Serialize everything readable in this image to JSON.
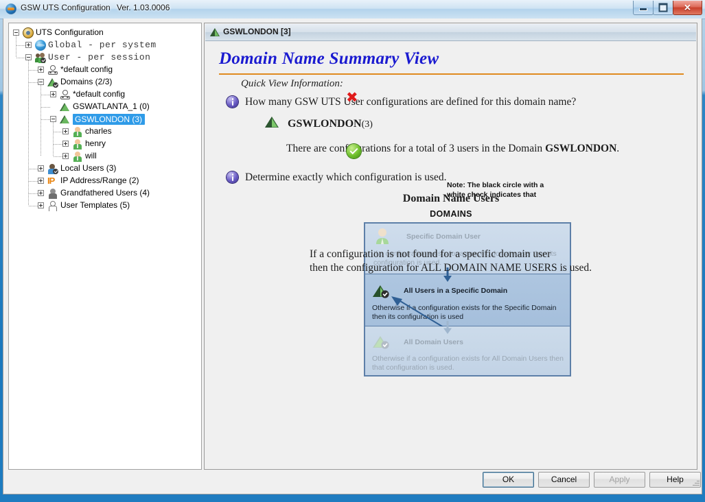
{
  "window": {
    "title": "GSW UTS Configuration",
    "version": "Ver. 1.03.0006",
    "icon": "app-globe-icon",
    "minimize_label": "–",
    "maximize_label": "",
    "close_label": "✕"
  },
  "tree": {
    "items": [
      {
        "label": "UTS Configuration",
        "icon": "gear-icon",
        "depth": 0,
        "expander": "minus",
        "selected": false,
        "mono": false
      },
      {
        "label": "Global  -  per system",
        "icon": "globe-icon",
        "depth": 1,
        "expander": "plus",
        "selected": false,
        "mono": true
      },
      {
        "label": "User  -  per session",
        "icon": "users-icon",
        "depth": 1,
        "expander": "minus",
        "selected": false,
        "mono": true
      },
      {
        "label": "*default config",
        "icon": "config-icon",
        "depth": 2,
        "expander": "plus",
        "selected": false,
        "mono": false
      },
      {
        "label": "Domains (2/3)",
        "icon": "domain-check-icon",
        "depth": 2,
        "expander": "minus",
        "selected": false,
        "mono": false
      },
      {
        "label": "*default config",
        "icon": "config-icon",
        "depth": 3,
        "expander": "plus",
        "selected": false,
        "mono": false
      },
      {
        "label": "GSWATLANTA_1 (0)",
        "icon": "domain-icon",
        "depth": 3,
        "expander": "none",
        "selected": false,
        "mono": false
      },
      {
        "label": "GSWLONDON (3)",
        "icon": "domain-icon",
        "depth": 3,
        "expander": "minus",
        "selected": true,
        "mono": false
      },
      {
        "label": "charles",
        "icon": "user-icon",
        "depth": 4,
        "expander": "plus",
        "selected": false,
        "mono": false
      },
      {
        "label": "henry",
        "icon": "user-icon",
        "depth": 4,
        "expander": "plus",
        "selected": false,
        "mono": false
      },
      {
        "label": "will",
        "icon": "user-icon",
        "depth": 4,
        "expander": "plus",
        "selected": false,
        "mono": false
      },
      {
        "label": "Local Users (3)",
        "icon": "local-user-icon",
        "depth": 2,
        "expander": "plus",
        "selected": false,
        "mono": false
      },
      {
        "label": "IP Address/Range (2)",
        "icon": "ip-icon",
        "depth": 2,
        "expander": "plus",
        "selected": false,
        "mono": false
      },
      {
        "label": "Grandfathered Users (4)",
        "icon": "gray-user-icon",
        "depth": 2,
        "expander": "plus",
        "selected": false,
        "mono": false
      },
      {
        "label": "User Templates (5)",
        "icon": "outline-user-icon",
        "depth": 2,
        "expander": "plus",
        "selected": false,
        "mono": false
      }
    ]
  },
  "panel": {
    "header": "GSWLONDON [3]",
    "header_icon": "domain-icon",
    "title": "Domain Name Summary View",
    "quick_view_label": "Quick View Information:",
    "question_1": "How many GSW UTS User configurations are defined for this domain name?",
    "domain_name": "GSWLONDON",
    "domain_count": "(3)",
    "answer_1_pre": "There are configurations for a total of ",
    "answer_1_count": "3",
    "answer_1_mid": " users in the Domain ",
    "answer_1_domain": "GSWLONDON",
    "answer_1_post": ".",
    "question_2": "Determine exactly which configuration is used.",
    "closing_line_1": "If a configuration is not found for a specific domain user",
    "closing_line_2": "then the configuration for ALL DOMAIN NAME USERS is used."
  },
  "diagram": {
    "title": "Domain Name Users",
    "subtitle": "DOMAINS",
    "marks": {
      "reject": "✖",
      "accept": "check-icon"
    },
    "rows": [
      {
        "title": "Specific Domain User",
        "icon": "person-icon",
        "desc_line_1": "If a configuration exists for a specific domain user then its",
        "desc_line_2": "configuration is used.",
        "state": "dim"
      },
      {
        "title": "All Users in a Specific Domain",
        "icon": "domain-check-icon",
        "desc_line_1": "Otherwise if a configuration exists for the Specific Domain",
        "desc_line_2": "then its configuration is used",
        "state": "active"
      },
      {
        "title": "All Domain Users",
        "icon": "domain-check-light-icon",
        "desc_line_1": "Otherwise if a configuration exists for All Domain Users then",
        "desc_line_2": "that configuration is used.",
        "state": "dim"
      }
    ],
    "note_line_1": "Note: The black circle with a",
    "note_line_2": "white check indicates that"
  },
  "buttons": {
    "ok": "OK",
    "cancel": "Cancel",
    "apply": "Apply",
    "help": "Help"
  },
  "colors": {
    "accent_orange": "#e08a1e",
    "title_blue": "#1a1ad0",
    "selection_blue": "#2f9be8",
    "diagram_border": "#5d7fa8",
    "reject_red": "#e01b1b",
    "accept_green": "#6fc02c"
  }
}
